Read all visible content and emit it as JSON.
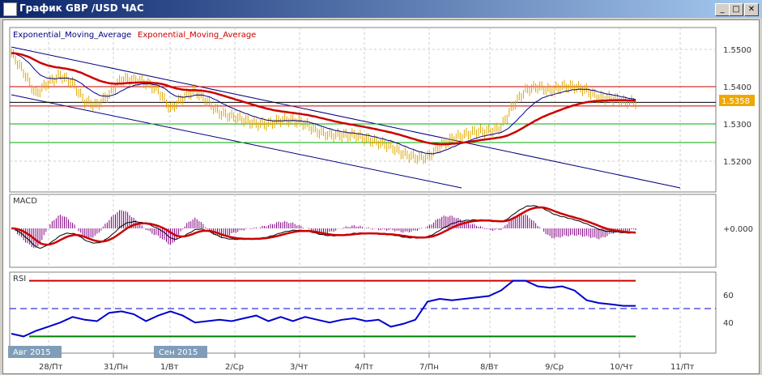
{
  "window": {
    "title": "График GBP /USD  ЧАС",
    "minimize": "_",
    "maximize": "□",
    "close": "✕"
  },
  "legend": {
    "ema1": "Exponential_Moving_Average",
    "ema2": "Exponential_Moving_Average",
    "ema1_color": "#000080",
    "ema2_color": "#cc0000"
  },
  "price_axis": {
    "labels": [
      "1.5500",
      "1.5400",
      "1.5300",
      "1.5200"
    ],
    "ticks": [
      1.55,
      1.54,
      1.53,
      1.52
    ],
    "current": "1.5358",
    "current_value": 1.5358,
    "current_color": "#f0a800"
  },
  "levels": [
    {
      "value": 1.54,
      "color": "#cc0000"
    },
    {
      "value": 1.5348,
      "color": "#cc0000"
    },
    {
      "value": 1.5358,
      "color": "#000000"
    },
    {
      "value": 1.53,
      "color": "#00aa00"
    },
    {
      "value": 1.525,
      "color": "#00aa00"
    }
  ],
  "macd": {
    "title": "MACD",
    "zero_label": "+0.000"
  },
  "rsi": {
    "title": "RSI",
    "labels": [
      "60",
      "40"
    ],
    "ticks": [
      60,
      40
    ],
    "upper": 70,
    "mid": 50,
    "lower": 30
  },
  "time_axis": {
    "months": [
      "Авг 2015",
      "Сен 2015"
    ],
    "days": [
      "28/Пт",
      "31/Пн",
      "1/Вт",
      "2/Ср",
      "3/Чт",
      "4/Пт",
      "7/Пн",
      "8/Вт",
      "9/Ср",
      "10/Чт",
      "11/Пт"
    ]
  },
  "chart_data": {
    "type": "line",
    "title": "График GBP /USD ЧАС",
    "close": [
      1.549,
      1.544,
      1.538,
      1.541,
      1.543,
      1.541,
      1.536,
      1.535,
      1.538,
      1.542,
      1.542,
      1.541,
      1.539,
      1.534,
      1.537,
      1.539,
      1.536,
      1.533,
      1.532,
      1.531,
      1.53,
      1.53,
      1.531,
      1.531,
      1.53,
      1.528,
      1.527,
      1.527,
      1.527,
      1.526,
      1.525,
      1.524,
      1.522,
      1.521,
      1.521,
      1.524,
      1.526,
      1.527,
      1.528,
      1.528,
      1.529,
      1.535,
      1.539,
      1.54,
      1.539,
      1.54,
      1.54,
      1.539,
      1.537,
      1.537,
      1.536,
      1.5358
    ],
    "rsi": [
      32,
      30,
      34,
      37,
      40,
      44,
      42,
      41,
      47,
      48,
      46,
      41,
      45,
      48,
      45,
      40,
      41,
      42,
      41,
      43,
      45,
      41,
      44,
      41,
      44,
      42,
      40,
      42,
      43,
      41,
      42,
      37,
      39,
      42,
      55,
      57,
      56,
      57,
      58,
      59,
      63,
      70,
      70,
      66,
      65,
      66,
      63,
      56,
      54,
      53,
      52,
      52
    ]
  }
}
